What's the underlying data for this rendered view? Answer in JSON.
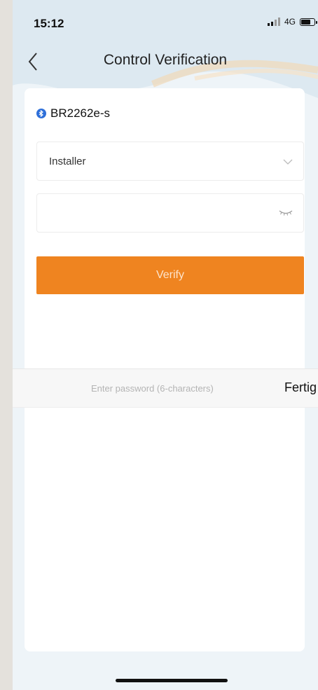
{
  "status_bar": {
    "time": "15:12",
    "network": "4G",
    "battery_level": 0.7
  },
  "nav": {
    "title": "Control Verification",
    "back_icon": "chevron-left-icon"
  },
  "device": {
    "name": "BR2262e-s",
    "icon": "bluetooth-icon",
    "icon_color": "#2e6fd9"
  },
  "role_select": {
    "value": "Installer",
    "icon": "chevron-down-icon"
  },
  "password": {
    "value": "",
    "placeholder": "",
    "toggle_icon": "eye-closed-icon"
  },
  "verify_button": {
    "label": "Verify",
    "color": "#ef8420"
  },
  "keyboard_toolbar": {
    "hint": "Enter password (6-characters)",
    "done_label": "Fertig"
  }
}
